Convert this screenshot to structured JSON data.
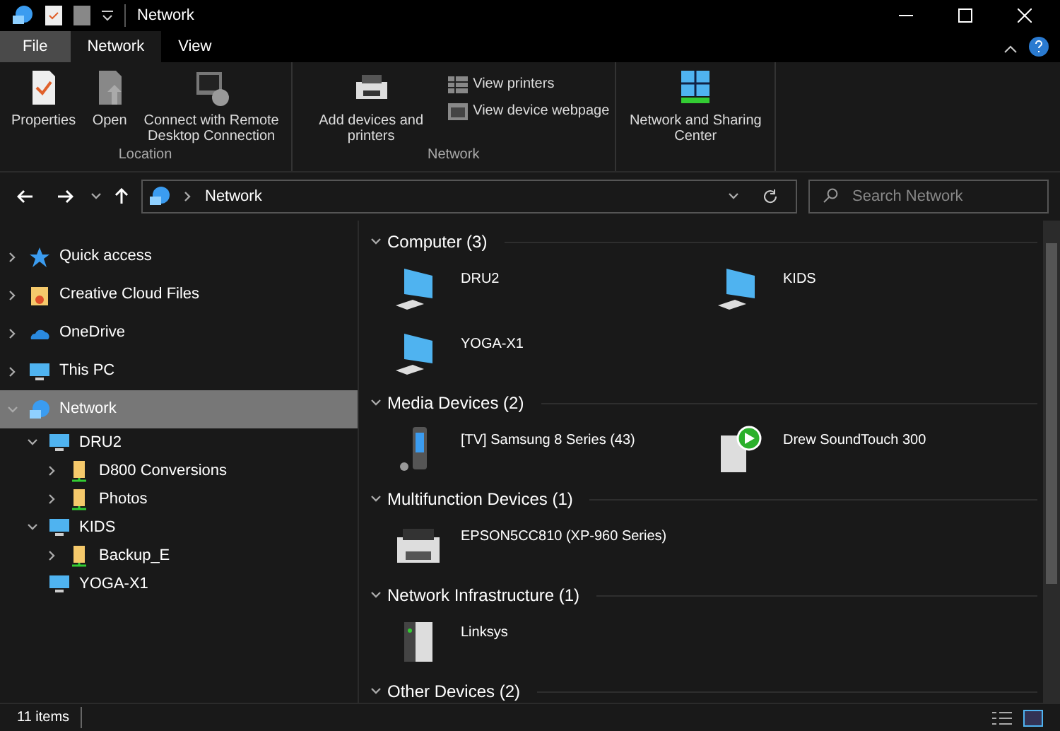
{
  "window": {
    "title": "Network"
  },
  "tabs": [
    {
      "label": "File",
      "kind": "file",
      "selected": false
    },
    {
      "label": "Network",
      "kind": "tab",
      "selected": true
    },
    {
      "label": "View",
      "kind": "tab",
      "selected": false
    }
  ],
  "ribbon": [
    {
      "label": "Location",
      "large": [
        {
          "label": "Properties",
          "kind": "properties"
        },
        {
          "label": "Open",
          "kind": "open"
        },
        {
          "label": "Connect with Remote Desktop Connection",
          "kind": "remote"
        }
      ]
    },
    {
      "label": "Network",
      "large": [
        {
          "label": "Add devices and printers",
          "kind": "add"
        }
      ],
      "small": [
        {
          "label": "View printers",
          "kind": "printers"
        },
        {
          "label": "View device webpage",
          "kind": "webpage"
        }
      ]
    },
    {
      "large": [
        {
          "label": "Network and Sharing Center",
          "kind": "sharing"
        }
      ]
    }
  ],
  "address": {
    "path": "Network",
    "search_placeholder": "Search Network"
  },
  "sidebar": {
    "items": [
      {
        "label": "Quick access",
        "kind": "star",
        "expanded": false,
        "selected": false
      },
      {
        "label": "Creative Cloud Files",
        "kind": "cc",
        "expanded": false,
        "selected": false
      },
      {
        "label": "OneDrive",
        "kind": "cloud",
        "expanded": false,
        "selected": false
      },
      {
        "label": "This PC",
        "kind": "pc",
        "expanded": false,
        "selected": false
      },
      {
        "label": "Network",
        "kind": "network",
        "expanded": true,
        "selected": true,
        "children": [
          {
            "label": "DRU2",
            "kind": "pc",
            "expanded": true,
            "selected": false,
            "children": [
              {
                "label": "D800 Conversions",
                "kind": "share",
                "expanded": false,
                "selected": false
              },
              {
                "label": "Photos",
                "kind": "share",
                "expanded": false,
                "selected": false
              }
            ]
          },
          {
            "label": "KIDS",
            "kind": "pc",
            "expanded": true,
            "selected": false,
            "children": [
              {
                "label": "Backup_E",
                "kind": "share",
                "expanded": false,
                "selected": false
              }
            ]
          },
          {
            "label": "YOGA-X1",
            "kind": "pc",
            "selected": false
          }
        ]
      }
    ]
  },
  "groups": [
    {
      "title": "Computer (3)",
      "items": [
        {
          "label": "DRU2",
          "kind": "pc"
        },
        {
          "label": "KIDS",
          "kind": "pc"
        },
        {
          "label": "YOGA-X1",
          "kind": "pc"
        }
      ]
    },
    {
      "title": "Media Devices (2)",
      "items": [
        {
          "label": "[TV] Samsung 8 Series (43)",
          "kind": "media"
        },
        {
          "label": "Drew SoundTouch 300",
          "kind": "player"
        }
      ]
    },
    {
      "title": "Multifunction Devices (1)",
      "items": [
        {
          "label": "EPSON5CC810 (XP-960 Series)",
          "kind": "printer"
        }
      ]
    },
    {
      "title": "Network Infrastructure (1)",
      "items": [
        {
          "label": "Linksys",
          "kind": "router"
        }
      ]
    },
    {
      "title": "Other Devices (2)"
    }
  ],
  "status_bar": {
    "count": "11 items"
  }
}
